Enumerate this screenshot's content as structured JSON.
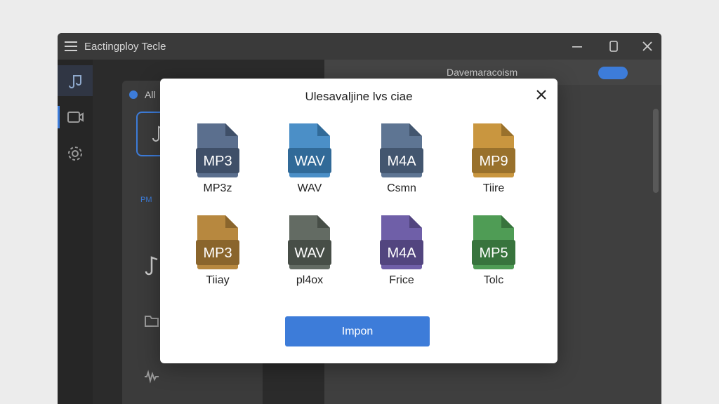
{
  "window": {
    "title": "Eactingploy Tecle"
  },
  "left_panel": {
    "tab_label": "All",
    "item_label": "PM"
  },
  "right_panel": {
    "header": "Davemaracoism"
  },
  "dialog": {
    "title": "Ulesavaljine lvs ciae",
    "files": [
      {
        "badge": "MP3",
        "caption": "MP3z",
        "color": "#5b6f8e",
        "fold": "#3f4f68"
      },
      {
        "badge": "WAV",
        "caption": "WAV",
        "color": "#4b8fc7",
        "fold": "#316a98"
      },
      {
        "badge": "M4A",
        "caption": "Csmn",
        "color": "#5e7593",
        "fold": "#43566f"
      },
      {
        "badge": "MP9",
        "caption": "Tiire",
        "color": "#c9963f",
        "fold": "#99712c"
      },
      {
        "badge": "MP3",
        "caption": "Tiiay",
        "color": "#b7883f",
        "fold": "#8a652c"
      },
      {
        "badge": "WAV",
        "caption": "pl4ox",
        "color": "#636b63",
        "fold": "#474e47"
      },
      {
        "badge": "M4A",
        "caption": "Frice",
        "color": "#6f5fa8",
        "fold": "#52457f"
      },
      {
        "badge": "MP5",
        "caption": "Tolc",
        "color": "#4f9c55",
        "fold": "#38743d"
      }
    ],
    "import_label": "Impon"
  }
}
